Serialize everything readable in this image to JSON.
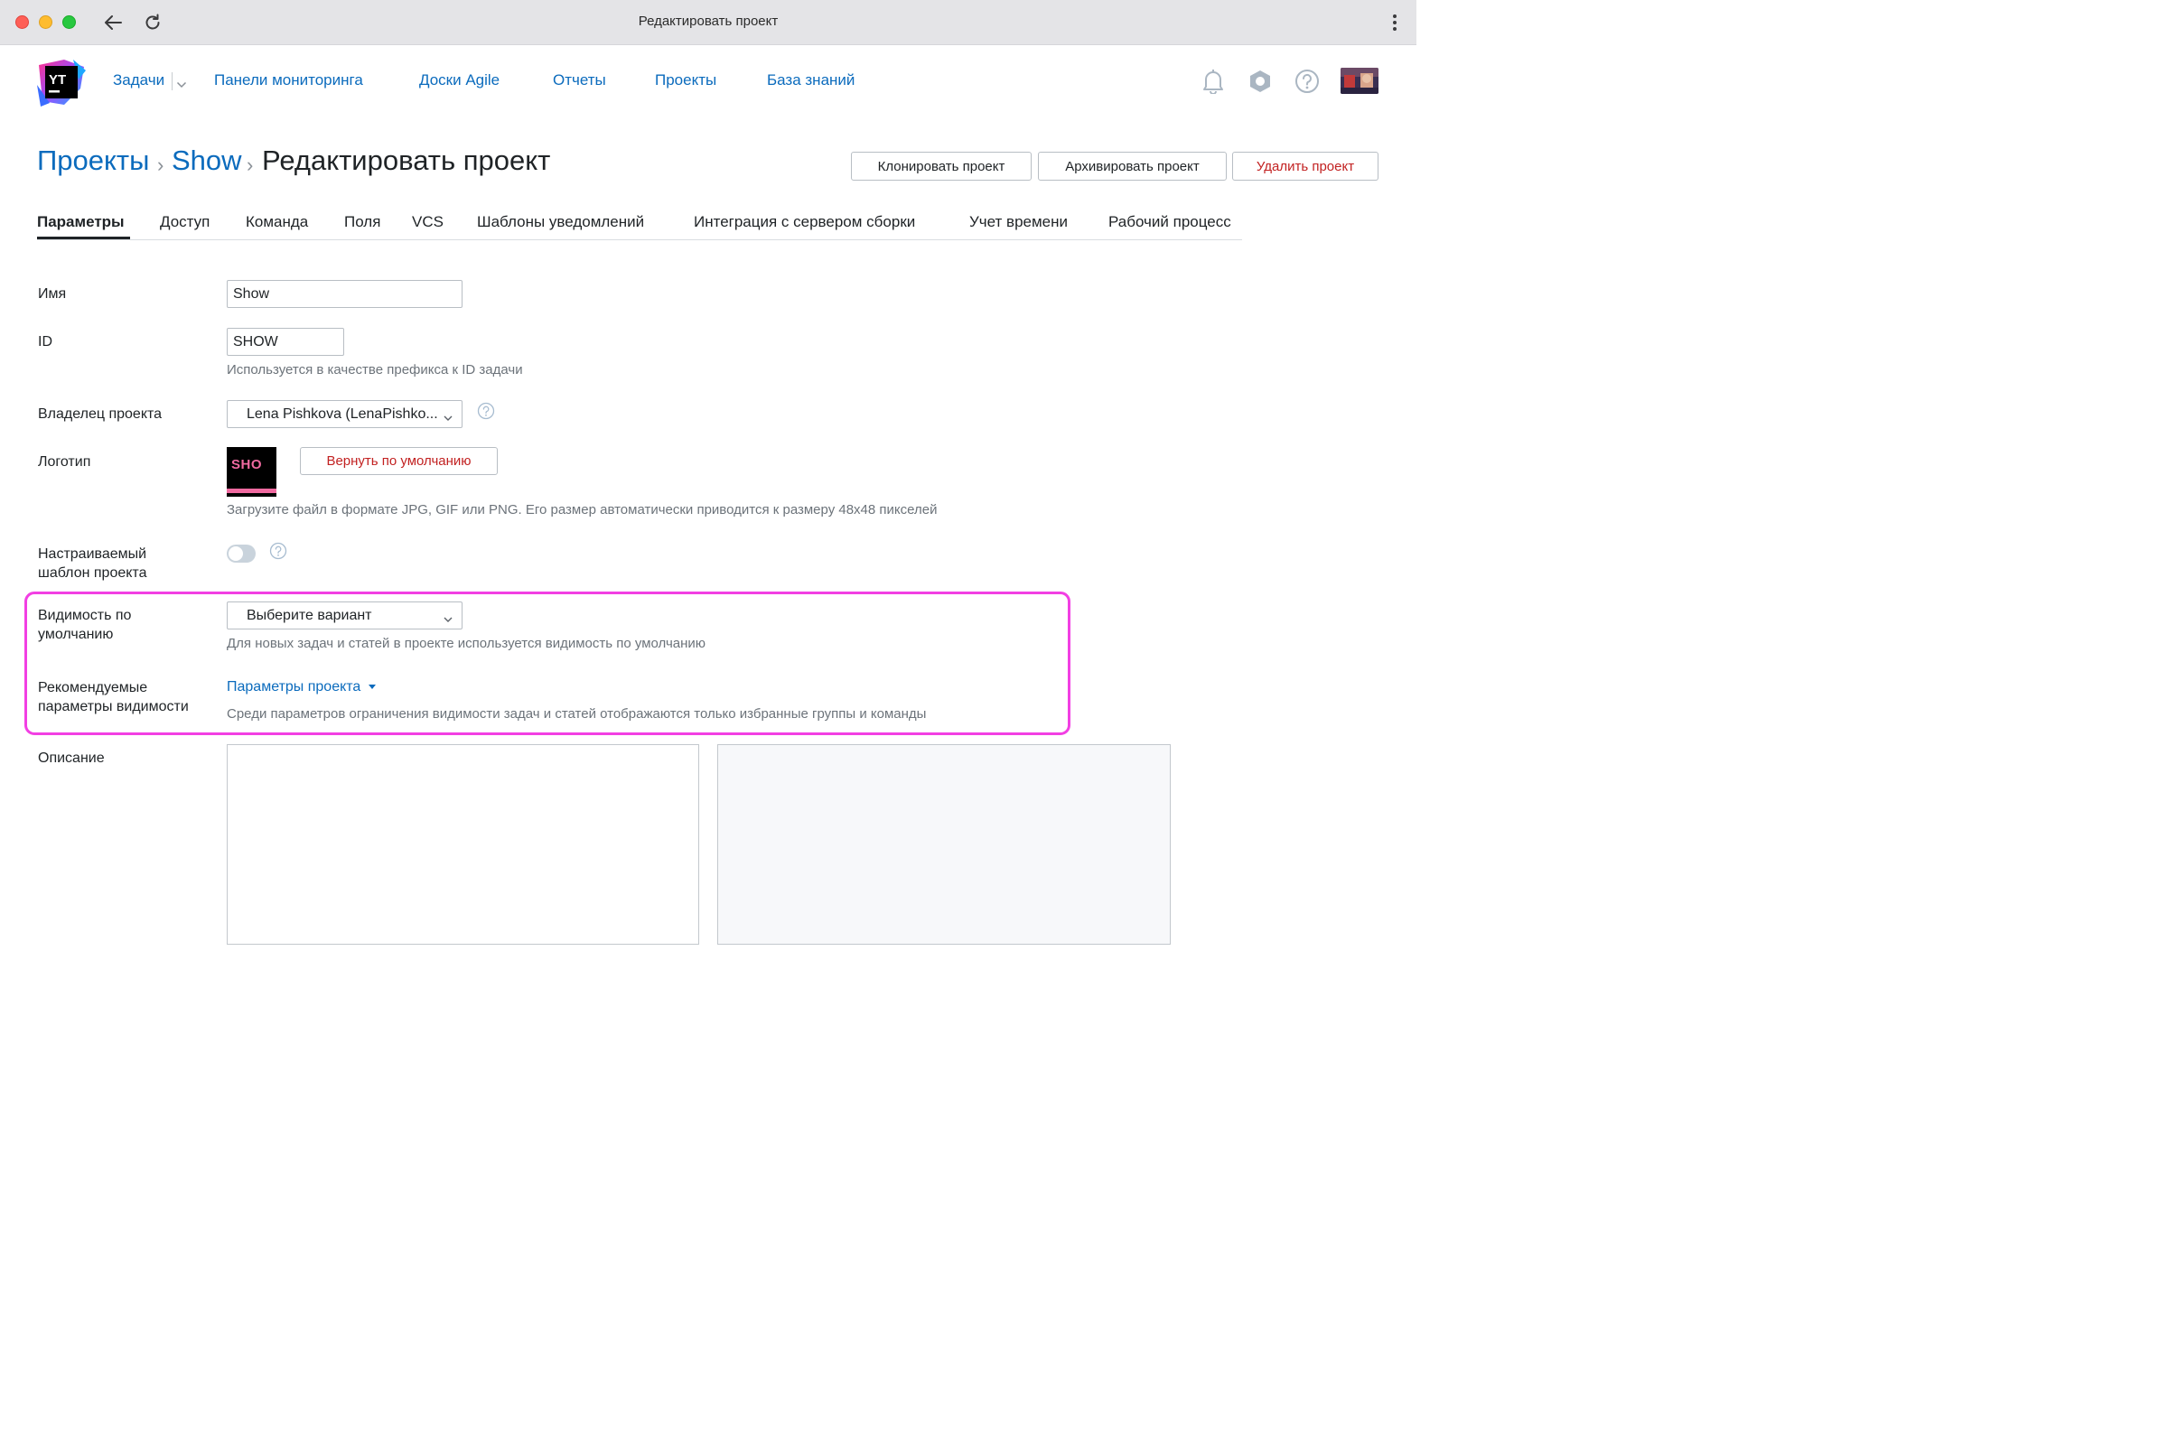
{
  "window": {
    "title": "Редактировать проект"
  },
  "header": {
    "logo_text": "YT",
    "nav": [
      {
        "label": "Задачи"
      },
      {
        "label": "Панели мониторинга"
      },
      {
        "label": "Доски Agile"
      },
      {
        "label": "Отчеты"
      },
      {
        "label": "Проекты"
      },
      {
        "label": "База знаний"
      }
    ],
    "icons": [
      "bell-icon",
      "gear-icon",
      "help-icon",
      "user-avatar"
    ]
  },
  "breadcrumb": {
    "root": "Проекты",
    "project": "Show",
    "current": "Редактировать проект",
    "separator": "›"
  },
  "actions": {
    "clone": "Клонировать проект",
    "archive": "Архивировать проект",
    "delete": "Удалить проект"
  },
  "tabs": [
    {
      "label": "Параметры",
      "active": true
    },
    {
      "label": "Доступ"
    },
    {
      "label": "Команда"
    },
    {
      "label": "Поля"
    },
    {
      "label": "VCS"
    },
    {
      "label": "Шаблоны уведомлений"
    },
    {
      "label": "Интеграция с сервером сборки"
    },
    {
      "label": "Учет времени"
    },
    {
      "label": "Рабочий процесс"
    }
  ],
  "form": {
    "name": {
      "label": "Имя",
      "value": "Show"
    },
    "id": {
      "label": "ID",
      "value": "SHOW",
      "hint": "Используется в качестве префикса к ID задачи"
    },
    "owner": {
      "label": "Владелец проекта",
      "value": "Lena Pishkova (LenaPishko..."
    },
    "logo": {
      "label": "Логотип",
      "image_text": "SHO",
      "reset_button": "Вернуть по умолчанию",
      "hint": "Загрузите файл в формате JPG, GIF или PNG. Его размер автоматически приводится к размеру 48x48 пикселей"
    },
    "template": {
      "label_line1": "Настраиваемый",
      "label_line2": "шаблон проекта",
      "enabled": false
    },
    "visibility": {
      "label_line1": "Видимость по",
      "label_line2": "умолчанию",
      "placeholder": "Выберите вариант",
      "hint": "Для новых задач и статей в проекте используется видимость по умолчанию"
    },
    "recommended": {
      "label_line1": "Рекомендуемые",
      "label_line2": "параметры видимости",
      "link": "Параметры проекта",
      "hint": "Среди параметров ограничения видимости задач и статей отображаются только избранные группы и команды"
    },
    "description": {
      "label": "Описание",
      "value": ""
    }
  },
  "colors": {
    "link": "#0b6bbd",
    "danger": "#c22121",
    "highlight": "#f23fe3"
  }
}
